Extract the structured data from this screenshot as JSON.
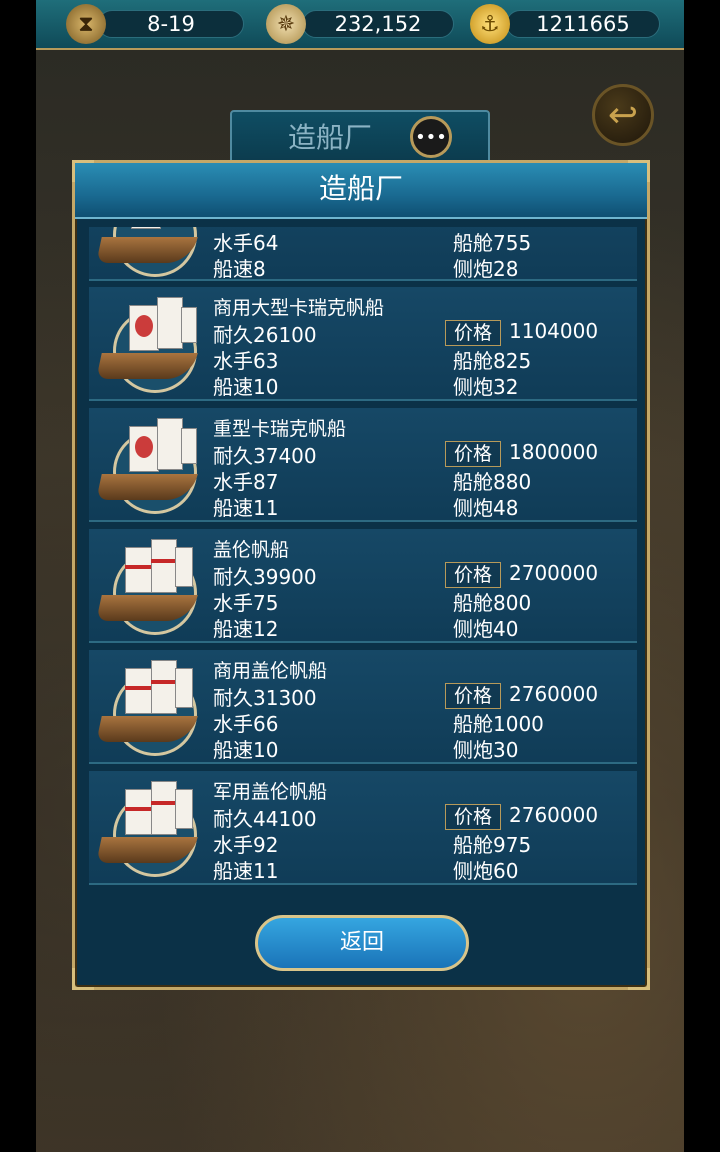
{
  "topbar": {
    "date": "8-19",
    "compass_value": "232,152",
    "gold": "1211665"
  },
  "behind": {
    "title": "造船厂",
    "chat_icon": "chat-bubble-icon",
    "back_icon": "back-arrow-icon"
  },
  "modal": {
    "title": "造船厂",
    "return_label": "返回",
    "labels": {
      "durability": "耐久",
      "sailors": "水手",
      "speed": "船速",
      "price": "价格",
      "cabin": "船舱",
      "cannon": "侧炮"
    },
    "partial_row": {
      "sailors": "64",
      "speed": "8",
      "cabin": "755",
      "cannon": "28"
    },
    "ships": [
      {
        "name": "商用大型卡瑞克帆船",
        "durability": "26100",
        "price": "1104000",
        "sailors": "63",
        "cabin": "825",
        "speed": "10",
        "cannon": "32",
        "style": "carrack"
      },
      {
        "name": "重型卡瑞克帆船",
        "durability": "37400",
        "price": "1800000",
        "sailors": "87",
        "cabin": "880",
        "speed": "11",
        "cannon": "48",
        "style": "carrack"
      },
      {
        "name": "盖伦帆船",
        "durability": "39900",
        "price": "2700000",
        "sailors": "75",
        "cabin": "800",
        "speed": "12",
        "cannon": "40",
        "style": "galleon"
      },
      {
        "name": "商用盖伦帆船",
        "durability": "31300",
        "price": "2760000",
        "sailors": "66",
        "cabin": "1000",
        "speed": "10",
        "cannon": "30",
        "style": "galleon"
      },
      {
        "name": "军用盖伦帆船",
        "durability": "44100",
        "price": "2760000",
        "sailors": "92",
        "cabin": "975",
        "speed": "11",
        "cannon": "60",
        "style": "galleon"
      }
    ]
  }
}
